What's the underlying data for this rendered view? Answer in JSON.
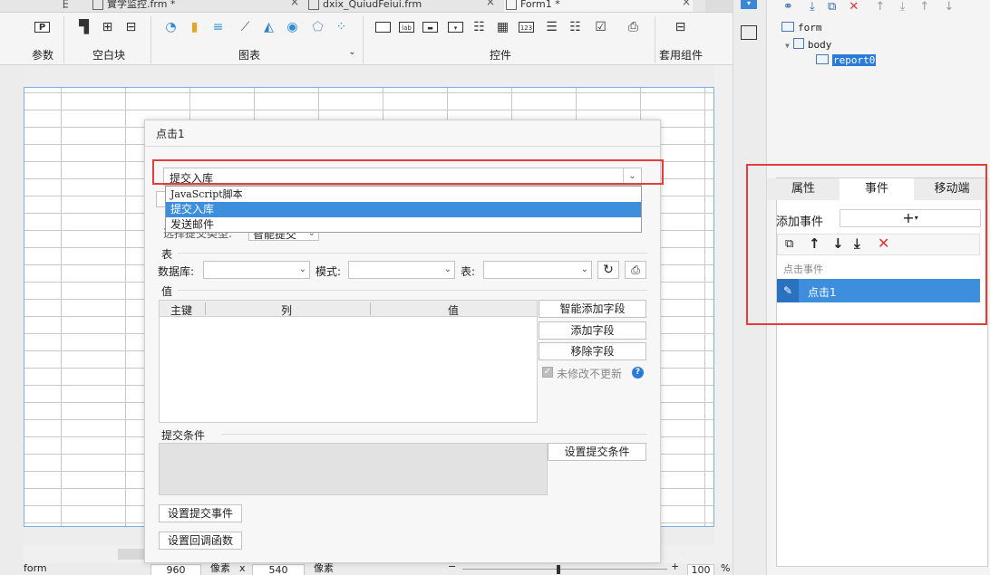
{
  "tabs": [
    {
      "label": "日† "
    },
    {
      "label": "實学监控.frm *"
    },
    {
      "label": "dxix_QuiudFeiui.frm"
    },
    {
      "label": "Form1 *"
    }
  ],
  "ribbon": {
    "param_label": "参数",
    "blank_label": "空白块",
    "chart_label": "图表",
    "control_label": "控件",
    "template_label": "套用组件"
  },
  "canvas": {
    "rows": 25
  },
  "status": {
    "form_label": "form",
    "width": "960",
    "unit1": "像素",
    "times": "x",
    "height": "540",
    "unit2": "像素",
    "minus": "−",
    "plus": "+",
    "zoom": "100",
    "pct": "%"
  },
  "tree": {
    "form": "form",
    "body": "body",
    "report": "report0"
  },
  "panel": {
    "tab_attr": "属性",
    "tab_event": "事件",
    "tab_mobile": "移动端",
    "add_event_label": "添加事件",
    "add_symbol": "+",
    "event_group": "点击事件",
    "event_item": "点击1"
  },
  "dialog": {
    "title": "点击1",
    "type_value": "提交入库",
    "dropdown_options": [
      "JavaScript脚本",
      "提交入库",
      "发送邮件"
    ],
    "select_type_label": "选择提交类型:",
    "select_type_value": "智能提交",
    "table_section": "表",
    "db_label": "数据库:",
    "mode_label": "模式:",
    "table_label": "表:",
    "value_section": "值",
    "col_key": "主键",
    "col_column": "列",
    "col_value": "值",
    "btn_smart_add": "智能添加字段",
    "btn_add_field": "添加字段",
    "btn_remove_field": "移除字段",
    "no_update_label": "未修改不更新",
    "help": "?",
    "submit_cond_section": "提交条件",
    "btn_set_cond": "设置提交条件",
    "btn_set_event": "设置提交事件",
    "btn_set_callback": "设置回调函数"
  }
}
